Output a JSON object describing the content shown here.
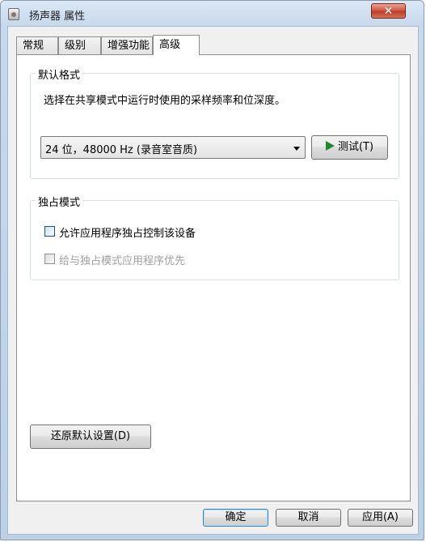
{
  "window": {
    "title": "扬声器 属性",
    "close_label": "✕"
  },
  "tabs": [
    {
      "label": "常规"
    },
    {
      "label": "级别"
    },
    {
      "label": "增强功能"
    },
    {
      "label": "高级"
    }
  ],
  "default_format": {
    "group_title": "默认格式",
    "description": "选择在共享模式中运行时使用的采样频率和位深度。",
    "selected_format": "24 位，48000 Hz (录音室音质)",
    "test_button_label": "测试(T)",
    "test_icon": "play-icon",
    "test_icon_color": "#1e8a2b"
  },
  "exclusive_mode": {
    "group_title": "独占模式",
    "allow_exclusive_label": "允许应用程序独占控制该设备",
    "allow_exclusive_checked": false,
    "priority_label": "给与独占模式应用程序优先",
    "priority_checked": false,
    "priority_enabled": false
  },
  "restore_defaults_label": "还原默认设置(D)",
  "footer": {
    "ok_label": "确定",
    "cancel_label": "取消",
    "apply_label": "应用(A)"
  }
}
